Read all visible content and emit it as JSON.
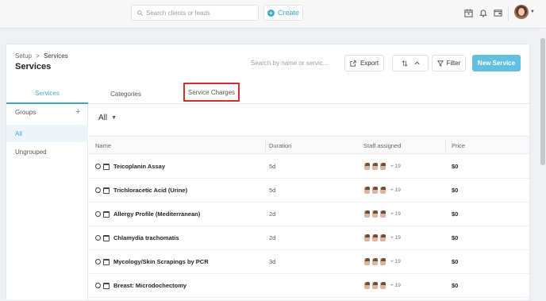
{
  "topbar": {
    "search_placeholder": "Search clients or leads",
    "create_label": "Create",
    "icons": [
      "calendar-icon",
      "bell-icon",
      "wallet-icon"
    ]
  },
  "header": {
    "breadcrumb_root": "Setup",
    "breadcrumb_sep": ">",
    "breadcrumb_current": "Services",
    "title": "Services",
    "search_placeholder": "Search by name or servic...",
    "export_label": "Export",
    "filter_label": "Filter",
    "new_label": "New Service"
  },
  "tabs": [
    {
      "label": "Services",
      "active": true
    },
    {
      "label": "Categories",
      "active": false
    },
    {
      "label": "Service Charges",
      "active": false,
      "highlighted": true
    }
  ],
  "sidebar": {
    "groups_label": "Groups",
    "items": [
      {
        "label": "All",
        "active": true
      },
      {
        "label": "Ungrouped",
        "active": false
      }
    ]
  },
  "main": {
    "filter_label": "All",
    "columns": [
      "Name",
      "Duration",
      "Staff assigned",
      "Price"
    ],
    "rows": [
      {
        "name": "Teicoplanin Assay",
        "duration": "5d",
        "staff_more": "+ 19",
        "price": "$0"
      },
      {
        "name": "Trichloracetic Acid (Urine)",
        "duration": "5d",
        "staff_more": "+ 19",
        "price": "$0"
      },
      {
        "name": "Allergy Profile (Mediterranean)",
        "duration": "2d",
        "staff_more": "+ 19",
        "price": "$0"
      },
      {
        "name": "Chlamydia trachomatis",
        "duration": "2d",
        "staff_more": "+ 19",
        "price": "$0"
      },
      {
        "name": "Mycology/Skin Scrapings by PCR",
        "duration": "3d",
        "staff_more": "+ 19",
        "price": "$0"
      },
      {
        "name": "Breast: Microdochectomy",
        "duration": "",
        "staff_more": "+ 19",
        "price": "$0"
      }
    ]
  },
  "colors": {
    "accent": "#3fa9c9",
    "primary_button": "#63bfe0",
    "highlight_box": "#d12f2f"
  }
}
